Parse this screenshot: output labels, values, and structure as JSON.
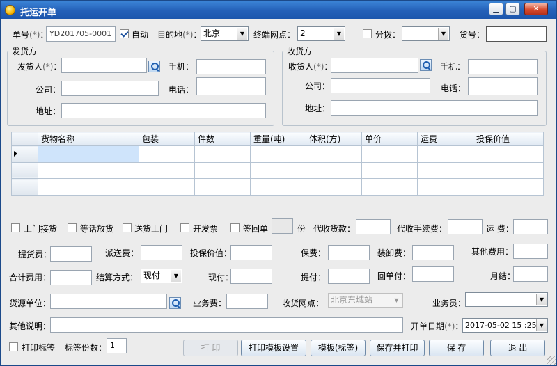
{
  "window": {
    "title": "托运开单"
  },
  "header": {
    "order_no_label": "单号",
    "order_no_value": "YD201705-0001",
    "auto_label": "自动",
    "dest_label": "目的地",
    "dest_value": "北京",
    "terminal_label": "终端网点：",
    "terminal_value": "2",
    "split_label": "分拨：",
    "split_value": "",
    "cargo_no_label": "货号：",
    "cargo_no_value": "",
    "req_mark": "(*)"
  },
  "sender": {
    "legend": "发货方",
    "name_label": "发货人",
    "mobile_label": "手机：",
    "company_label": "公司：",
    "phone_label": "电话：",
    "address_label": "地址："
  },
  "receiver": {
    "legend": "收货方",
    "name_label": "收货人",
    "mobile_label": "手机：",
    "company_label": "公司：",
    "phone_label": "电话：",
    "address_label": "地址："
  },
  "grid": {
    "columns": [
      "货物名称",
      "包装",
      "件数",
      "重量(吨)",
      "体积(方)",
      "单价",
      "运费",
      "投保价值"
    ],
    "rows": [
      [
        "",
        "",
        "",
        "",
        "",
        "",
        "",
        ""
      ],
      [
        "",
        "",
        "",
        "",
        "",
        "",
        "",
        ""
      ],
      [
        "",
        "",
        "",
        "",
        "",
        "",
        "",
        ""
      ]
    ]
  },
  "options": {
    "pickup": "上门接货",
    "wait_notice": "等话放货",
    "delivery": "送货上门",
    "invoice": "开发票",
    "sign_return": "签回单",
    "copies_unit": "份",
    "cod_label": "代收货款：",
    "cod_fee_label": "代收手续费：",
    "freight_label": "运 费："
  },
  "fees": {
    "pickup_fee": "提货费：",
    "dispatch_fee": "派送费：",
    "insured_value": "投保价值：",
    "insurance_fee": "保费：",
    "handling_fee": "装卸费：",
    "other_fee": "其他费用：",
    "total_fee": "合计费用：",
    "payment_method": "结算方式：",
    "payment_value": "现付",
    "cash_pay": "现付：",
    "pickup_pay": "提付：",
    "return_pay": "回单付：",
    "monthly": "月结："
  },
  "source": {
    "unit_label": "货源单位：",
    "business_fee": "业务费：",
    "receive_point_label": "收货网点：",
    "receive_point_value": "北京东城站",
    "salesman_label": "业务员："
  },
  "remark": {
    "label": "其他说明：",
    "date_label": "开单日期",
    "date_value": "2017-05-02 15 :25"
  },
  "footer": {
    "print_label_check": "打印标签",
    "label_count_label": "标签份数：",
    "label_count_value": "1",
    "btn_print": "打 印",
    "btn_template": "打印模板设置",
    "btn_label_template": "模板(标签)",
    "btn_save_print": "保存并打印",
    "btn_save": "保 存",
    "btn_exit": "退 出"
  }
}
